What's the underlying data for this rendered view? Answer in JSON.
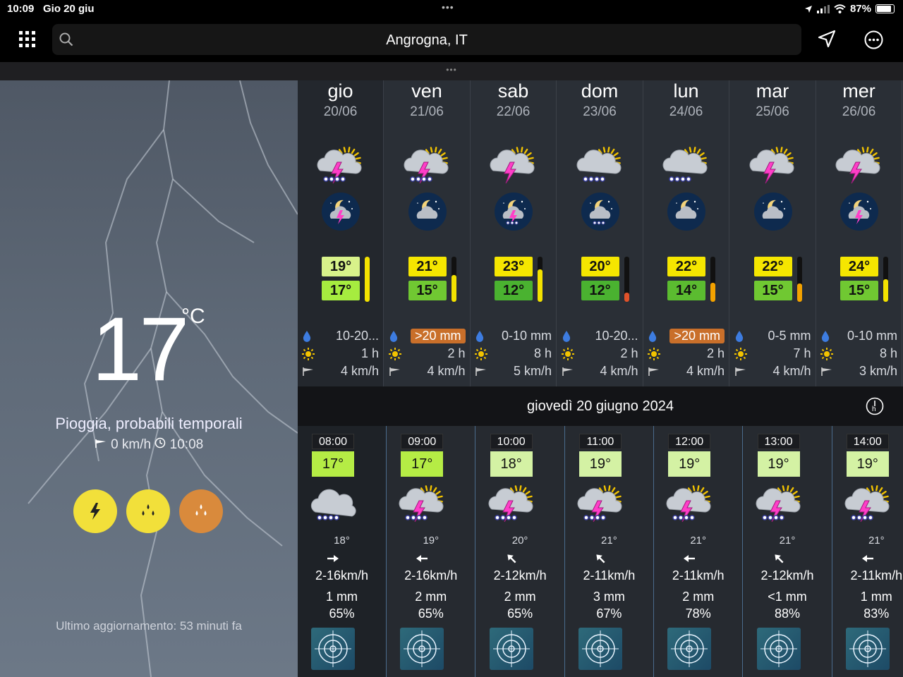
{
  "status": {
    "time": "10:09",
    "date": "Gio 20 giu",
    "battery": "87%",
    "battery_level": 0.87,
    "multitask": "•••"
  },
  "search": {
    "location": "Angrogna, IT"
  },
  "grip": "•••",
  "current": {
    "temp": "17",
    "unit": "°C",
    "condition": "Pioggia, probabili temporali",
    "wind": "0 km/h",
    "observed": "10:08",
    "alerts": [
      {
        "name": "lightning-icon",
        "color": "#f2e03a"
      },
      {
        "name": "rain-icon",
        "color": "#f2e03a"
      },
      {
        "name": "rain-heavy-icon",
        "color": "#d98a3c"
      }
    ],
    "updated": "Ultimo aggiornamento: 53 minuti fa"
  },
  "days": [
    {
      "name": "gio",
      "date": "20/06",
      "icon": "sun-cloud-storm-rain-icon",
      "night_icon": "moon-storm-icon",
      "tmax": "19°",
      "tmin": "17°",
      "tmax_color": "#d8f28a",
      "tmin_color": "#a6ec3f",
      "bar_level": 1.0,
      "bar_color": "#f3e200",
      "rain": "10-20...",
      "rain_pill": false,
      "sun": "1 h",
      "wind": "4 km/h"
    },
    {
      "name": "ven",
      "date": "21/06",
      "icon": "sun-cloud-storm-rain-icon",
      "night_icon": "moon-cloud-icon",
      "tmax": "21°",
      "tmin": "15°",
      "tmax_color": "#f5e600",
      "tmin_color": "#70c832",
      "bar_level": 0.6,
      "bar_color": "#f3e200",
      "rain": ">20 mm",
      "rain_pill": true,
      "sun": "2 h",
      "wind": "4 km/h"
    },
    {
      "name": "sab",
      "date": "22/06",
      "icon": "sun-cloud-storm-icon",
      "night_icon": "moon-storm-rain-icon",
      "tmax": "23°",
      "tmin": "12°",
      "tmax_color": "#f5e600",
      "tmin_color": "#4ab230",
      "bar_level": 0.72,
      "bar_color": "#f3e200",
      "rain": "0-10 mm",
      "rain_pill": false,
      "sun": "8 h",
      "wind": "5 km/h"
    },
    {
      "name": "dom",
      "date": "23/06",
      "icon": "sun-cloud-rain-icon",
      "night_icon": "moon-cloud-rain-icon",
      "tmax": "20°",
      "tmin": "12°",
      "tmax_color": "#f5e600",
      "tmin_color": "#4ab230",
      "bar_level": 0.2,
      "bar_color": "#e0522a",
      "rain": "10-20...",
      "rain_pill": false,
      "sun": "2 h",
      "wind": "4 km/h"
    },
    {
      "name": "lun",
      "date": "24/06",
      "icon": "sun-cloud-rain-icon",
      "night_icon": "moon-cloud-icon",
      "tmax": "22°",
      "tmin": "14°",
      "tmax_color": "#f5e600",
      "tmin_color": "#5bbc30",
      "bar_level": 0.42,
      "bar_color": "#f3a200",
      "rain": ">20 mm",
      "rain_pill": true,
      "sun": "2 h",
      "wind": "4 km/h"
    },
    {
      "name": "mar",
      "date": "25/06",
      "icon": "sun-cloud-storm-icon",
      "night_icon": "moon-cloud-icon",
      "tmax": "22°",
      "tmin": "15°",
      "tmax_color": "#f5e600",
      "tmin_color": "#70c832",
      "bar_level": 0.4,
      "bar_color": "#f3a200",
      "rain": "0-5 mm",
      "rain_pill": false,
      "sun": "7 h",
      "wind": "4 km/h"
    },
    {
      "name": "mer",
      "date": "26/06",
      "icon": "sun-cloud-storm-icon",
      "night_icon": "moon-storm-icon",
      "tmax": "24°",
      "tmin": "15°",
      "tmax_color": "#f5e600",
      "tmin_color": "#70c832",
      "bar_level": 0.5,
      "bar_color": "#f3e200",
      "rain": "0-10 mm",
      "rain_pill": false,
      "sun": "8 h",
      "wind": "3 km/h"
    }
  ],
  "day_header": "giovedì 20 giugno 2024",
  "hours": [
    {
      "time": "08:00",
      "temp": "17°",
      "temp_color": "#b5ec45",
      "icon": "cloud-rain-icon",
      "feels": "18°",
      "wind_dir": "east",
      "wind": "2-16km/h",
      "rain": "1 mm",
      "humidity": "65%"
    },
    {
      "time": "09:00",
      "temp": "17°",
      "temp_color": "#b5ec45",
      "icon": "sun-cloud-storm-rain-icon",
      "feels": "19°",
      "wind_dir": "west",
      "wind": "2-16km/h",
      "rain": "2 mm",
      "humidity": "65%"
    },
    {
      "time": "10:00",
      "temp": "18°",
      "temp_color": "#d4f2a4",
      "icon": "sun-cloud-storm-rain-icon",
      "feels": "20°",
      "wind_dir": "north-west",
      "wind": "2-12km/h",
      "rain": "2 mm",
      "humidity": "65%"
    },
    {
      "time": "11:00",
      "temp": "19°",
      "temp_color": "#d4f2a4",
      "icon": "sun-cloud-storm-rain-icon",
      "feels": "21°",
      "wind_dir": "north-west",
      "wind": "2-11km/h",
      "rain": "3 mm",
      "humidity": "67%"
    },
    {
      "time": "12:00",
      "temp": "19°",
      "temp_color": "#d4f2a4",
      "icon": "sun-cloud-storm-rain-icon",
      "feels": "21°",
      "wind_dir": "west",
      "wind": "2-11km/h",
      "rain": "2 mm",
      "humidity": "78%"
    },
    {
      "time": "13:00",
      "temp": "19°",
      "temp_color": "#d4f2a4",
      "icon": "sun-cloud-storm-rain-icon",
      "feels": "21°",
      "wind_dir": "north-west",
      "wind": "2-12km/h",
      "rain": "<1 mm",
      "humidity": "88%"
    },
    {
      "time": "14:00",
      "temp": "19°",
      "temp_color": "#d4f2a4",
      "icon": "sun-cloud-storm-rain-icon",
      "feels": "21°",
      "wind_dir": "west",
      "wind": "2-11km/h",
      "rain": "1 mm",
      "humidity": "83%"
    }
  ]
}
